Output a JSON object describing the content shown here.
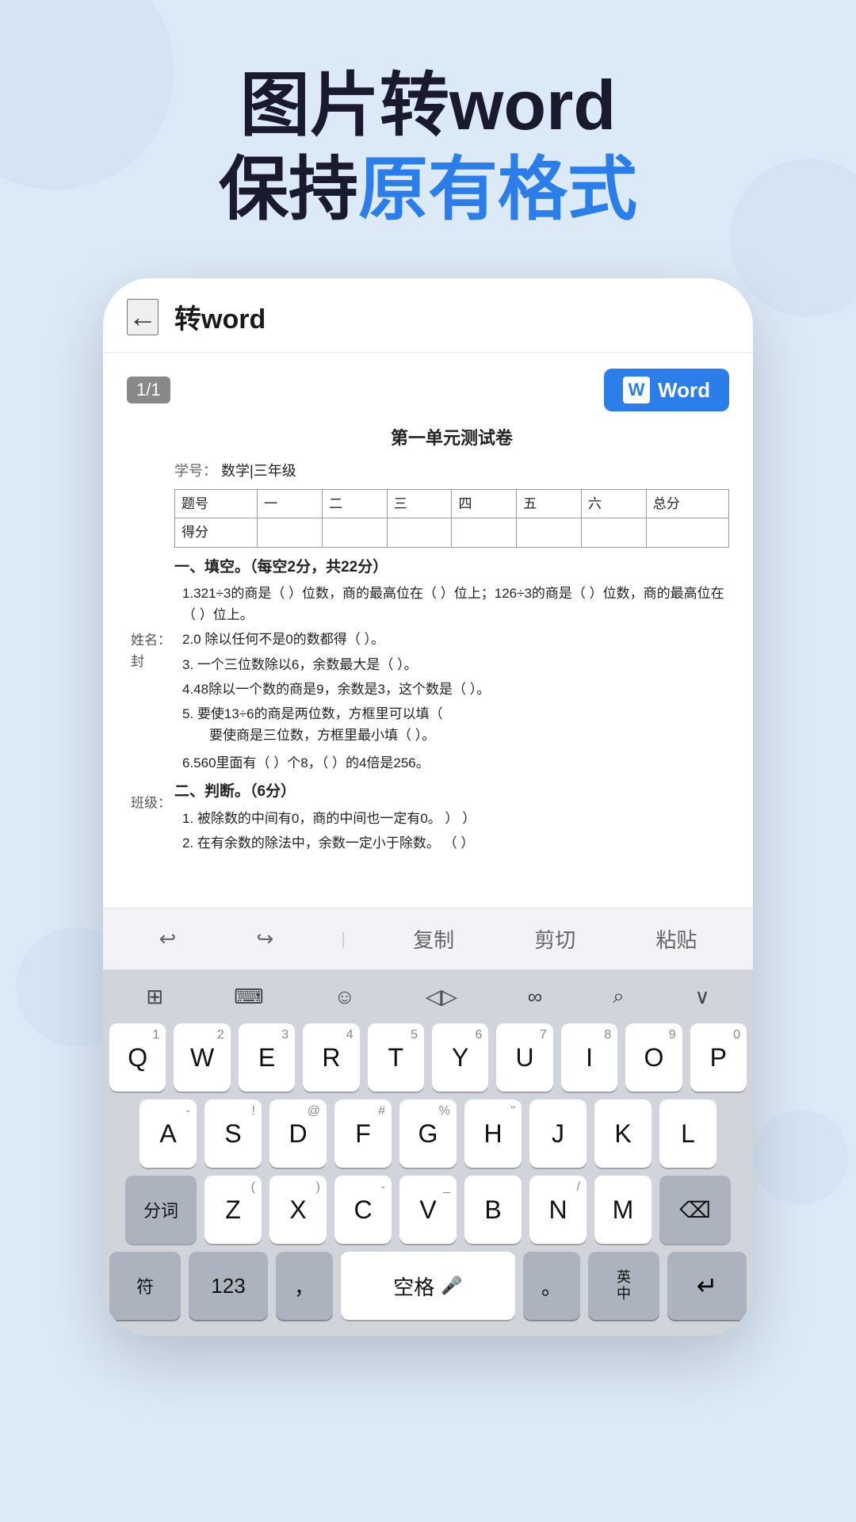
{
  "hero": {
    "line1": "图片转word",
    "line2_prefix": "保持",
    "line2_accent": "原有格式",
    "accent_color": "#2b7de9"
  },
  "app": {
    "header": {
      "back_icon": "←",
      "title": "转word"
    },
    "doc": {
      "page_indicator": "1/1",
      "word_btn_label": "Word",
      "content": {
        "title": "第一单元测试卷",
        "info_label": "学号：",
        "info_value": "数学|三年级",
        "table_headers": [
          "题号",
          "一",
          "二",
          "三",
          "四",
          "五",
          "六",
          "总分"
        ],
        "table_row2": [
          "得分",
          "",
          "",
          "",
          "",
          "",
          "",
          ""
        ],
        "sections": [
          {
            "title": "一、填空。（每空2分，共22分）",
            "questions": [
              "1.321÷3的商是（ ）位数，商的最高位在（ ）位上；126÷3的商是（ ）位数，商的最高位在（ ）位上。",
              "2.0 除以任何不是0的数都得（ ）。",
              "3. 一个三位数除以6，余数最大是（ ）。",
              "4.48除以一个数的商是9，余数是3，这个数是（ ）。",
              "5. 要使13÷6的商是两位数，方框里可以填（要使商是三位数，方框里最小填（ ）。",
              "6.560里面有（ ）个8，（ ）的4倍是256。"
            ]
          },
          {
            "title": "二、判断。（6分）",
            "questions": [
              "1. 被除数的中间有0，商的中间也一定有0。    ）                 ）",
              "2. 在有余数的除法中，余数一定小于除数。   （ ）"
            ]
          }
        ],
        "sidebar_labels": [
          "姓名：\n封",
          "班级："
        ]
      }
    }
  },
  "edit_toolbar": {
    "undo": "↩",
    "redo": "↪",
    "copy": "复制",
    "cut": "剪切",
    "paste": "粘贴"
  },
  "keyboard": {
    "toolbar_icons": [
      "⊞",
      "⊟",
      "☺",
      "◁▷",
      "∞",
      "⌕",
      "∨"
    ],
    "row1": [
      {
        "main": "Q",
        "sub": "1"
      },
      {
        "main": "W",
        "sub": "2"
      },
      {
        "main": "E",
        "sub": "3"
      },
      {
        "main": "R",
        "sub": "4"
      },
      {
        "main": "T",
        "sub": "5"
      },
      {
        "main": "Y",
        "sub": "6"
      },
      {
        "main": "U",
        "sub": "7"
      },
      {
        "main": "I",
        "sub": "8"
      },
      {
        "main": "O",
        "sub": "9"
      },
      {
        "main": "P",
        "sub": "0"
      }
    ],
    "row2": [
      {
        "main": "A",
        "sub": "-"
      },
      {
        "main": "S",
        "sub": "!"
      },
      {
        "main": "D",
        "sub": "@"
      },
      {
        "main": "F",
        "sub": "#"
      },
      {
        "main": "G",
        "sub": "%"
      },
      {
        "main": "H",
        "sub": "\""
      },
      {
        "main": "J",
        "sub": ""
      },
      {
        "main": "K",
        "sub": ""
      },
      {
        "main": "L",
        "sub": ""
      }
    ],
    "row3_left": "分词",
    "row3": [
      {
        "main": "Z",
        "sub": "("
      },
      {
        "main": "X",
        "sub": ")"
      },
      {
        "main": "C",
        "sub": "-"
      },
      {
        "main": "V",
        "sub": "_"
      },
      {
        "main": "B",
        "sub": ""
      },
      {
        "main": "N",
        "sub": "/"
      },
      {
        "main": "M",
        "sub": ""
      }
    ],
    "row3_right": "⌫",
    "bottom": {
      "sym": "符",
      "num": "123",
      "comma": "，",
      "space": "空格",
      "period": "。",
      "lang": "英\n中",
      "enter": "↵"
    }
  }
}
